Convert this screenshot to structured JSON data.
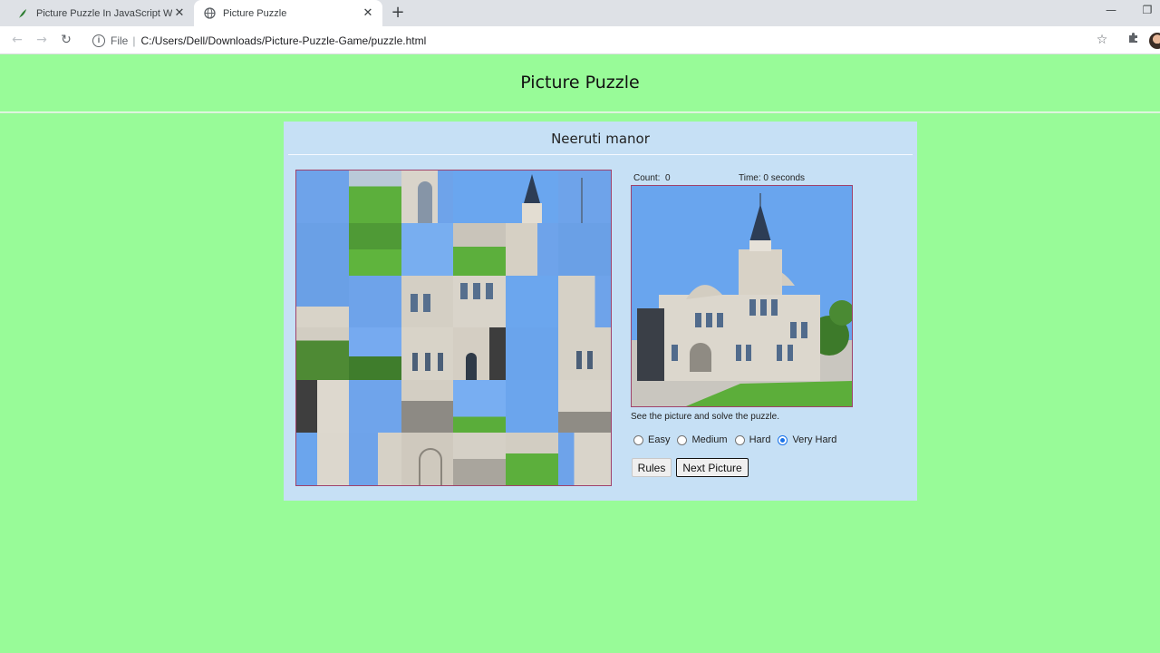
{
  "browser": {
    "tabs": [
      {
        "title": "Picture Puzzle In JavaScript With",
        "active": false
      },
      {
        "title": "Picture Puzzle",
        "active": true
      }
    ],
    "url_scheme": "File",
    "url": "C:/Users/Dell/Downloads/Picture-Puzzle-Game/puzzle.html"
  },
  "page": {
    "title": "Picture Puzzle",
    "picture_name": "Neeruti manor",
    "count_label": "Count:",
    "count_value": "0",
    "time_label": "Time:",
    "time_value": "0 seconds",
    "hint": "See the picture and solve the puzzle.",
    "levels": [
      {
        "label": "Easy",
        "checked": false
      },
      {
        "label": "Medium",
        "checked": false
      },
      {
        "label": "Hard",
        "checked": false
      },
      {
        "label": "Very Hard",
        "checked": true
      }
    ],
    "rules_button": "Rules",
    "next_button": "Next Picture"
  },
  "colors": {
    "page_bg": "#98fb98",
    "panel_bg": "#c6e0f5",
    "frame_border": "#a0426b",
    "sky": "#6fa2e6",
    "grass": "#5cae3a",
    "building": "#d8d3c8"
  }
}
